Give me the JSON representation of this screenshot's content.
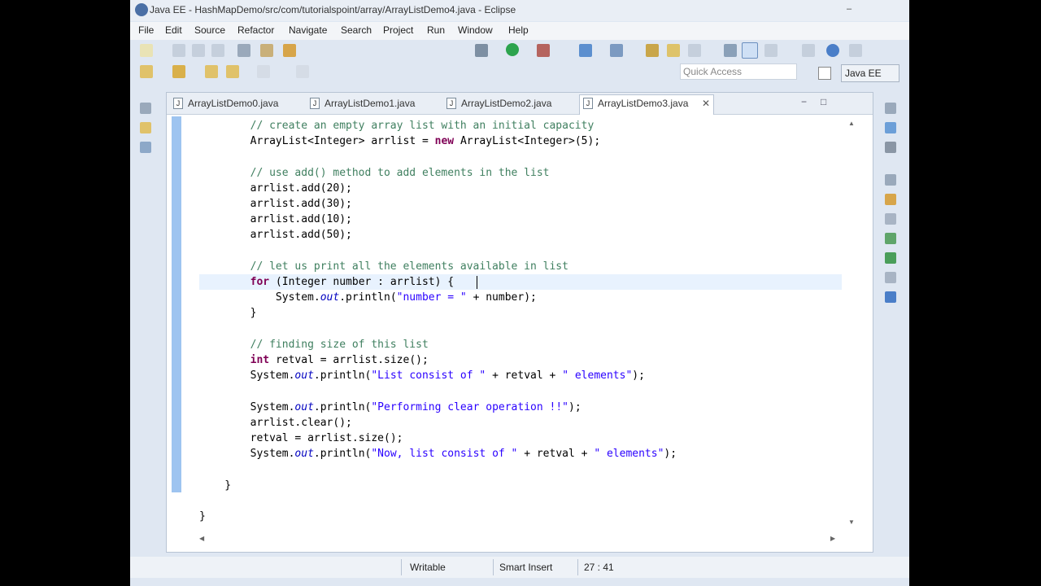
{
  "window": {
    "title": "Java EE - HashMapDemo/src/com/tutorialspoint/array/ArrayListDemo4.java - Eclipse",
    "minimize_glyph": "–"
  },
  "menu": [
    "File",
    "Edit",
    "Source",
    "Refactor",
    "Navigate",
    "Search",
    "Project",
    "Run",
    "Window",
    "Help"
  ],
  "toolbar": {
    "quick_access_placeholder": "Quick Access",
    "perspective_label": "Java EE"
  },
  "tabs": [
    {
      "label": "ArrayListDemo0.java",
      "active": false
    },
    {
      "label": "ArrayListDemo1.java",
      "active": false
    },
    {
      "label": "ArrayListDemo2.java",
      "active": false
    },
    {
      "label": "ArrayListDemo3.java",
      "active": true
    }
  ],
  "tab_icon_letter": "J",
  "tab_close_glyph": "✕",
  "view_controls": {
    "minimize": "−",
    "maximize": "□"
  },
  "code": {
    "lines": [
      "        // create an empty array list with an initial capacity",
      "        ArrayList<Integer> arrlist = new ArrayList<Integer>(5);",
      "",
      "        // use add() method to add elements in the list",
      "        arrlist.add(20);",
      "        arrlist.add(30);",
      "        arrlist.add(10);",
      "        arrlist.add(50);",
      "",
      "        // let us print all the elements available in list",
      "        for (Integer number : arrlist) {",
      "            System.out.println(\"number = \" + number);",
      "        }",
      "",
      "        // finding size of this list",
      "        int retval = arrlist.size();",
      "        System.out.println(\"List consist of \" + retval + \" elements\");",
      "",
      "        System.out.println(\"Performing clear operation !!\");",
      "        arrlist.clear();",
      "        retval = arrlist.size();",
      "        System.out.println(\"Now, list consist of \" + retval + \" elements\");",
      "",
      "    }",
      "",
      "}"
    ],
    "current_line_index": 10
  },
  "scroll_glyphs": {
    "up": "▲",
    "down": "▼",
    "left": "◀",
    "right": "▶"
  },
  "status": {
    "writable": "Writable",
    "insert_mode": "Smart Insert",
    "position": "27 : 41"
  },
  "colors": {
    "comment": "#3f7f5f",
    "keyword": "#7f0055",
    "string": "#2a00ff",
    "field": "#0000c0",
    "current_line": "#e8f2fe",
    "gutter_marker": "#9ec4f0"
  }
}
